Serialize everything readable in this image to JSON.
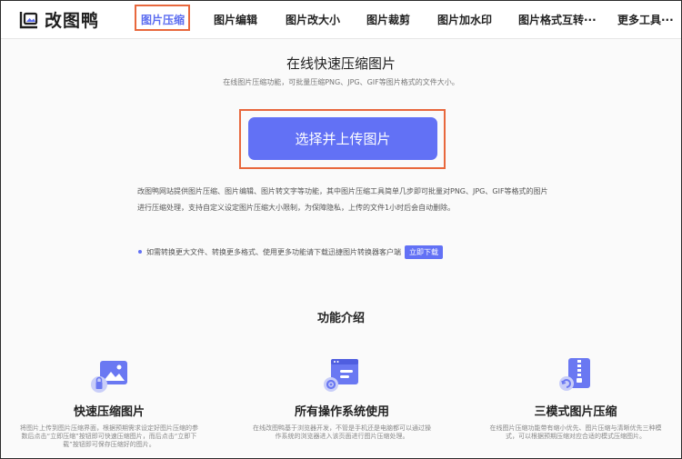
{
  "header": {
    "logo_text": "改图鸭",
    "nav": [
      {
        "label": "图片压缩",
        "active": true
      },
      {
        "label": "图片编辑"
      },
      {
        "label": "图片改大小"
      },
      {
        "label": "图片裁剪"
      },
      {
        "label": "图片加水印"
      },
      {
        "label": "图片格式互转···"
      },
      {
        "label": "更多工具···"
      }
    ]
  },
  "hero": {
    "title": "在线快速压缩图片",
    "subtitle": "在线图片压缩功能，可批量压缩PNG、JPG、GIF等图片格式的文件大小。",
    "upload_label": "选择并上传图片"
  },
  "description": "改图鸭网站提供图片压缩、图片编辑、图片转文字等功能，其中图片压缩工具简单几步即可批量对PNG、JPG、GIF等格式的图片进行压缩处理，支持自定义设定图片压缩大小限制，为保障隐私，上传的文件1小时后会自动删除。",
  "notice": {
    "text": "如需转换更大文件、转换更多格式、使用更多功能请下载迅捷图片转换器客户端",
    "button": "立即下载"
  },
  "features_section": {
    "title": "功能介绍",
    "items": [
      {
        "icon": "image-compress-icon",
        "title": "快速压缩图片",
        "desc": "将图片上传到图片压缩界面，根据预期需求设定好图片压缩的参数后点击“立即压缩”按钮即可快速压缩图片，而后点击“立即下载”按钮即可保存压缩好的图片。"
      },
      {
        "icon": "browser-settings-icon",
        "title": "所有操作系统使用",
        "desc": "在线改图鸭基于浏览器开发，不管是手机还是电脑都可以通过操作系统的浏览器进入该页面进行图片压缩处理。"
      },
      {
        "icon": "zip-file-icon",
        "title": "三模式图片压缩",
        "desc": "在线图片压缩功能带有缩小优先、图片压缩与清晰优先三种模式，可以根据预期压缩对应合适的模式压缩图片。"
      }
    ]
  },
  "colors": {
    "accent": "#6271f5",
    "highlight_outline": "#e8683d"
  }
}
